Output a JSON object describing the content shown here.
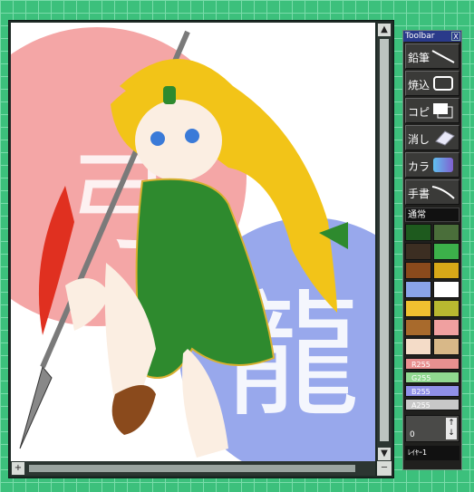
{
  "toolbar": {
    "title": "Toolbar",
    "close": "X",
    "tools": [
      {
        "label": "鉛筆",
        "icon": "pencil-line-icon"
      },
      {
        "label": "焼込",
        "icon": "burn-rect-icon"
      },
      {
        "label": "コピ",
        "icon": "copy-rect-icon"
      },
      {
        "label": "消し",
        "icon": "eraser-icon"
      },
      {
        "label": "カラ",
        "icon": "color-gradient-icon"
      },
      {
        "label": "手書",
        "icon": "freehand-line-icon"
      }
    ],
    "mode": "通常",
    "swatches": [
      "#1e5a1e",
      "#4a6e3a",
      "#3c2e22",
      "#3cb04a",
      "#8a4a1c",
      "#d8a818",
      "#8aa4e8",
      "#ffffff",
      "#f0c030",
      "#b8b830",
      "#a86a2c",
      "#f0a0a0",
      "#f4dcc8",
      "#d8b888"
    ],
    "sliders": [
      {
        "label": "R255",
        "color": "#e89090"
      },
      {
        "label": "G255",
        "color": "#90d890"
      },
      {
        "label": "B255",
        "color": "#9090e8"
      },
      {
        "label": "A255",
        "color": "#c8c8c8"
      }
    ],
    "stepper_value": "0",
    "layer": "ﾚｲﾔｰ1"
  },
  "canvas": {
    "corner_label": "+",
    "kanji": "龍",
    "colors": {
      "red_circle": "#f4a6a6",
      "blue_circle": "#98a8ec",
      "dress": "#2e8a2e",
      "hair": "#f2c418",
      "skin": "#fbeee2"
    }
  },
  "scroll": {
    "up": "▲",
    "down": "▼",
    "left": "+",
    "right": "─"
  }
}
